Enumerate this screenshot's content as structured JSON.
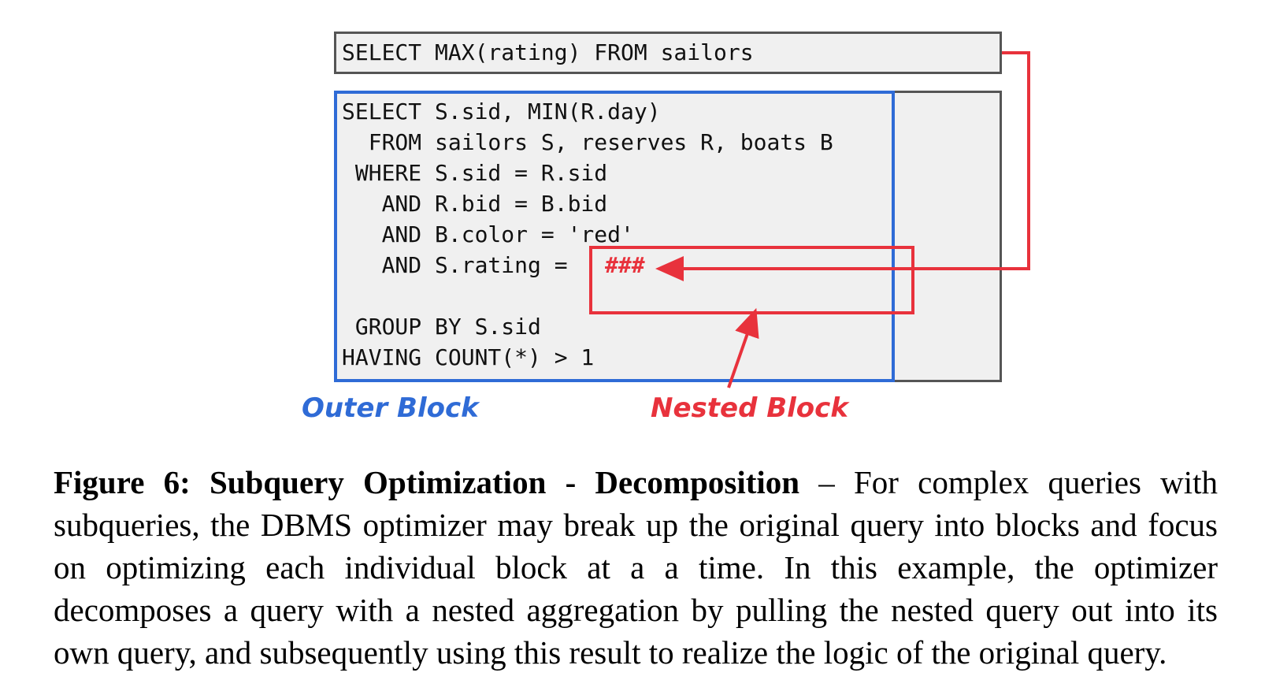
{
  "diagram": {
    "top_query": "SELECT MAX(rating) FROM sailors",
    "outer_lines": [
      "SELECT S.sid, MIN(R.day)",
      "  FROM sailors S, reserves R, boats B",
      " WHERE S.sid = R.sid",
      "   AND R.bid = B.bid",
      "   AND B.color = 'red'",
      "   AND S.rating =",
      "",
      " GROUP BY S.sid",
      "HAVING COUNT(*) > 1"
    ],
    "placeholder": "###",
    "outer_label": "Outer Block",
    "nested_label": "Nested Block",
    "colors": {
      "outer": "#2f6bd6",
      "nested": "#e8323c",
      "box_fill": "#f0f0f0",
      "box_border": "#555555"
    }
  },
  "caption": {
    "figure_title": "Figure 6:  Subquery Optimization - Decomposition",
    "body": " – For complex queries with subqueries, the DBMS optimizer may break up the original query into blocks and focus on optimizing each individual block at a a time. In this example, the optimizer decomposes a query with a nested aggregation by pulling the nested query out into its own query, and subsequently using this result to realize the logic of the original query."
  }
}
